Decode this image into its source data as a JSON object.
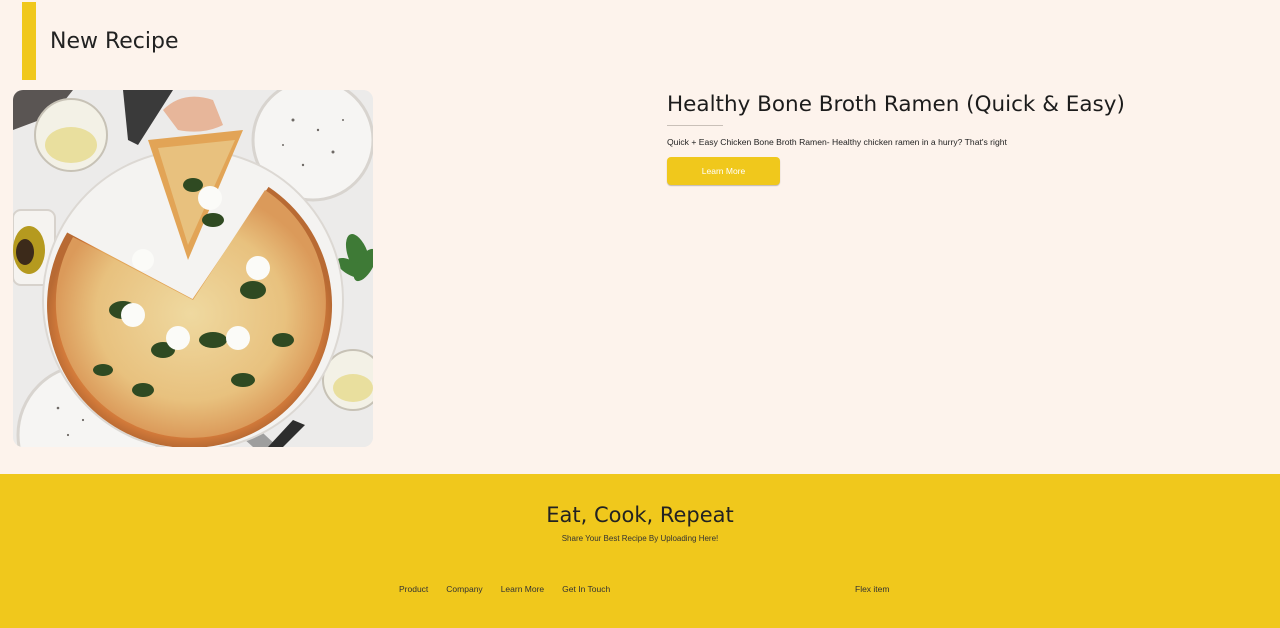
{
  "section": {
    "title": "New Recipe"
  },
  "recipe": {
    "title": "Healthy Bone Broth Ramen (Quick & Easy)",
    "description": "Quick + Easy Chicken Bone Broth Ramen- Healthy chicken ramen in a hurry? That's right",
    "button_label": "Learn More",
    "image_alt": "Pizza with spinach and mozzarella"
  },
  "footer": {
    "title": "Eat, Cook, Repeat",
    "subtitle": "Share Your Best Recipe By Uploading Here!",
    "links": [
      {
        "label": "Product"
      },
      {
        "label": "Company"
      },
      {
        "label": "Learn More"
      },
      {
        "label": "Get In Touch"
      }
    ],
    "flex_item": "Flex item"
  },
  "colors": {
    "accent": "#f0c81c",
    "background": "#fdf3ec"
  }
}
